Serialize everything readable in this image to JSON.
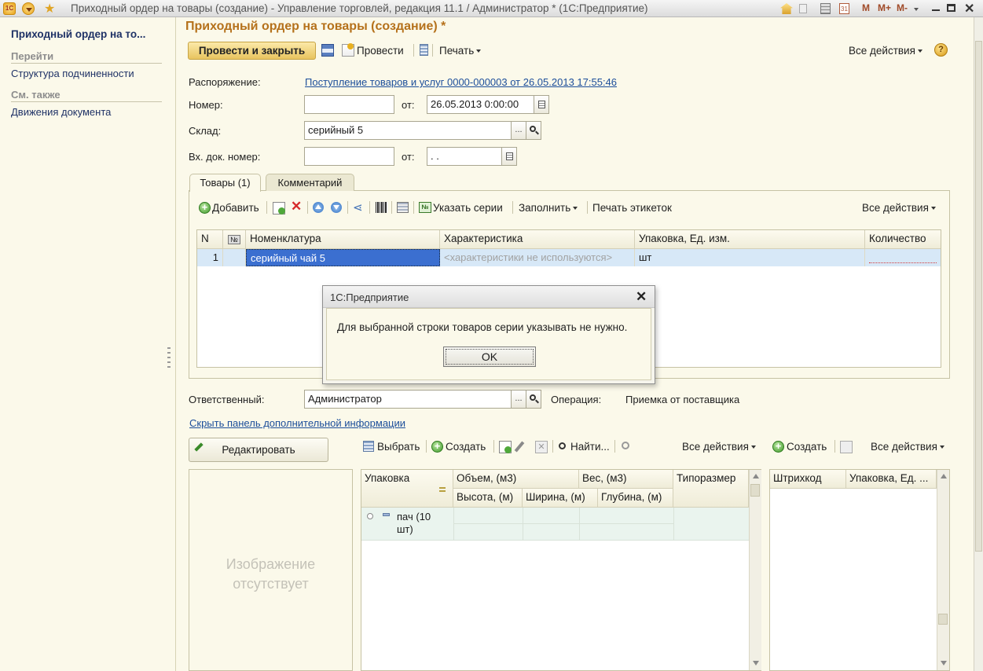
{
  "window": {
    "title": "Приходный ордер на товары (создание) - Управление торговлей, редакция 11.1 / Администратор *  (1С:Предприятие)",
    "app_icon_label": "1С",
    "right_tools": {
      "m": "M",
      "m_plus": "M+",
      "m_minus": "M-"
    }
  },
  "left_panel": {
    "doc_title": "Приходный ордер на то...",
    "sections": [
      {
        "title": "Перейти",
        "links": [
          "Структура подчиненности"
        ]
      },
      {
        "title": "См. также",
        "links": [
          "Движения документа"
        ]
      }
    ]
  },
  "form": {
    "title": "Приходный ордер на товары (создание) *",
    "toolbar": {
      "post_close": "Провести и закрыть",
      "post": "Провести",
      "print": "Печать",
      "all_actions": "Все действия",
      "help": "?"
    },
    "fields": {
      "order_label": "Распоряжение:",
      "order_link": "Поступление товаров и услуг 0000-000003 от 26.05.2013 17:55:46",
      "number_label": "Номер:",
      "number_value": "",
      "from_label": "от:",
      "date_value": "26.05.2013  0:00:00",
      "warehouse_label": "Склад:",
      "warehouse_value": "серийный 5",
      "in_doc_label": "Вх. док. номер:",
      "in_doc_value": "",
      "in_date_value": " .  .",
      "ellipsis": "..."
    },
    "tabs": [
      {
        "label": "Товары (1)",
        "active": true
      },
      {
        "label": "Комментарий",
        "active": false
      }
    ],
    "goods_toolbar": {
      "add": "Добавить",
      "set_series": "Указать серии",
      "fill": "Заполнить",
      "print_labels": "Печать этикеток",
      "all_actions": "Все действия"
    },
    "goods_table": {
      "columns": [
        "N",
        "№",
        "Номенклатура",
        "Характеристика",
        "Упаковка, Ед. изм.",
        "Количество"
      ],
      "rows": [
        {
          "n": "1",
          "item": "серийный чай 5",
          "characteristic": "<характеристики не используются>",
          "unit": "шт",
          "qty": ""
        }
      ]
    },
    "responsible_label": "Ответственный:",
    "responsible_value": "Администратор",
    "operation_label": "Операция:",
    "operation_value": "Приемка от поставщика",
    "hide_panel_link": "Скрыть панель дополнительной информации",
    "edit_button": "Редактировать",
    "image_placeholder": [
      "Изображение",
      "отсутствует"
    ],
    "packages_toolbar": {
      "select": "Выбрать",
      "create": "Создать",
      "find": "Найти...",
      "all_actions": "Все действия"
    },
    "packages_table": {
      "col_pack": "Упаковка",
      "col_volume": "Объем, (м3)",
      "col_weight": "Вес, (м3)",
      "col_size": "Типоразмер",
      "sub_height": "Высота, (м)",
      "sub_width": "Ширина, (м)",
      "sub_depth": "Глубина, (м)",
      "rows": [
        {
          "pack_line1": "пач (10",
          "pack_line2": "шт)"
        }
      ]
    },
    "barcodes_toolbar": {
      "create": "Создать",
      "all_actions": "Все действия"
    },
    "barcodes_table": {
      "col_barcode": "Штрихкод",
      "col_pack": "Упаковка, Ед. ..."
    }
  },
  "dialog": {
    "title": "1С:Предприятие",
    "message": "Для выбранной строки товаров серии указывать не нужно.",
    "ok": "OK",
    "close": "✕"
  },
  "colors": {
    "background": "#fbf9ea",
    "title_accent": "#b5711b",
    "primary_button": "#e8c45f",
    "selected_row": "#d7e8f7",
    "link": "#1c4e9a"
  }
}
